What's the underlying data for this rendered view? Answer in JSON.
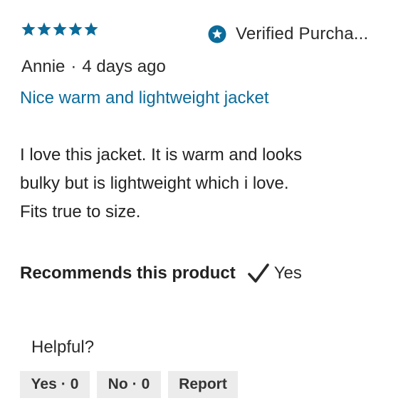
{
  "colors": {
    "star": "#0b6b9a",
    "title": "#0b6b9a",
    "verified_icon": "#0b6b9a",
    "button_bg": "#ececec"
  },
  "review": {
    "rating": 5,
    "rating_max": 5,
    "verified": {
      "icon": "star-badge-icon",
      "label": "Verified Purcha..."
    },
    "author": "Annie",
    "separator": "·",
    "date": "4 days ago",
    "title": "Nice warm and lightweight jacket",
    "body_lines": [
      "I love this jacket. It is warm and looks",
      "bulky but is lightweight which i love.",
      "Fits true to size."
    ],
    "recommend": {
      "label": "Recommends this product",
      "icon": "checkmark-icon",
      "value": "Yes"
    }
  },
  "helpful": {
    "label": "Helpful?",
    "yes": {
      "label": "Yes",
      "sep": "·",
      "count": "0"
    },
    "no": {
      "label": "No",
      "sep": "·",
      "count": "0"
    },
    "report": {
      "label": "Report"
    }
  }
}
